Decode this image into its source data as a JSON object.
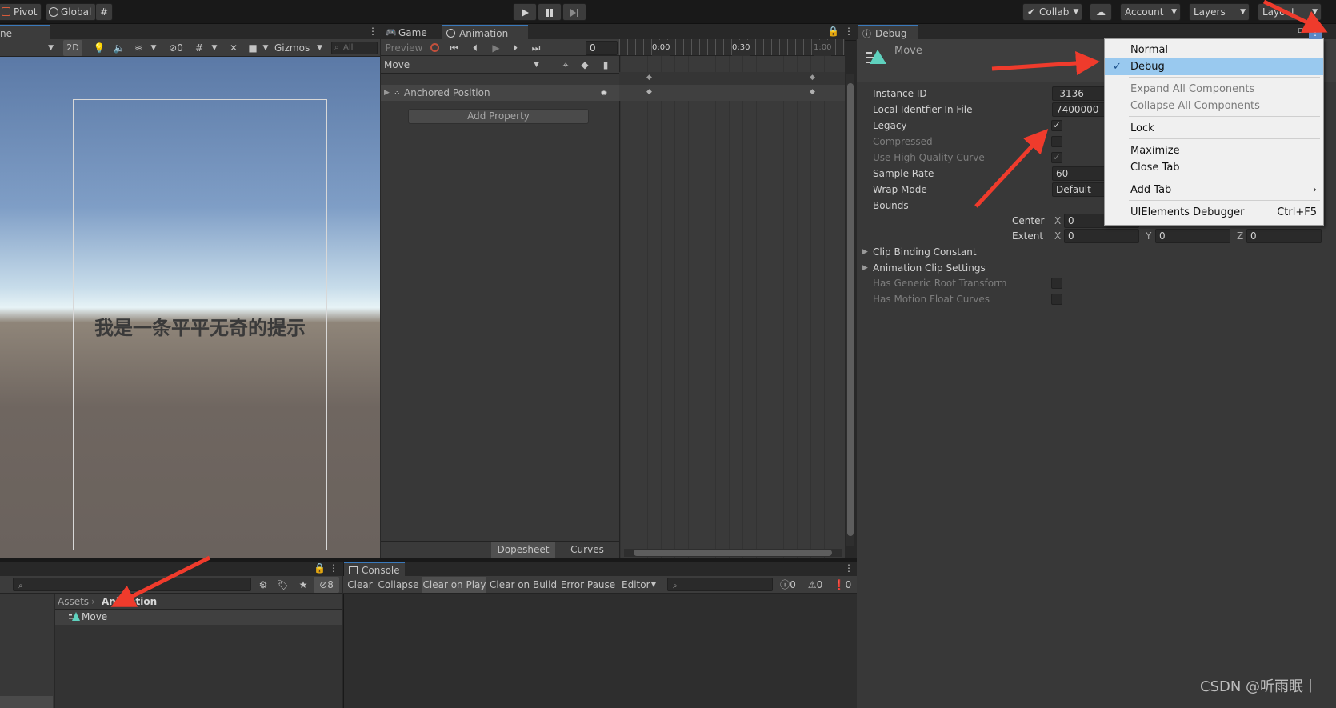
{
  "top_toolbar": {
    "pivot": "Pivot",
    "global": "Global",
    "collab": "Collab",
    "account": "Account",
    "layers": "Layers",
    "layout": "Layout"
  },
  "scene": {
    "tab_label": "ne",
    "mode_2d": "2D",
    "hidden_count": "0",
    "gizmos": "Gizmos",
    "search_placeholder": "All",
    "viewport_text": "我是一条平平无奇的提示"
  },
  "game_tab": "Game",
  "animation": {
    "tab_label": "Animation",
    "preview": "Preview",
    "frame_value": "0",
    "clip_select": "Move",
    "property": "Anchored Position",
    "add_property": "Add Property",
    "ruler_ticks": [
      "0:00",
      "0:30",
      "1:00"
    ],
    "bottom_tabs": [
      "Dopesheet",
      "Curves"
    ]
  },
  "inspector": {
    "tab_label": "Debug",
    "object_name": "Move",
    "rows": [
      {
        "label": "Instance ID",
        "value": "-3136",
        "dim": false
      },
      {
        "label": "Local Identfier In File",
        "value": "7400000",
        "dim": false
      },
      {
        "label": "Legacy",
        "value": "✓",
        "dim": false
      },
      {
        "label": "Compressed",
        "value": "",
        "dim": true
      },
      {
        "label": "Use High Quality Curve",
        "value": "✓",
        "dim": true
      },
      {
        "label": "Sample Rate",
        "value": "60",
        "dim": false
      },
      {
        "label": "Wrap Mode",
        "value": "Default",
        "dim": false
      },
      {
        "label": "Bounds",
        "value": "",
        "dim": false
      }
    ],
    "center_label": "Center",
    "extent_label": "Extent",
    "axis_labels": [
      "X",
      "Y",
      "Z"
    ],
    "center_x": "0",
    "extent_values": [
      "0",
      "0",
      "0"
    ],
    "foldouts": [
      "Clip Binding Constant",
      "Animation Clip Settings"
    ],
    "extra_rows": [
      "Has Generic Root Transform",
      "Has Motion Float Curves"
    ]
  },
  "context_menu": {
    "items": [
      {
        "label": "Normal",
        "shortcut": "",
        "disabled": false,
        "selected": false
      },
      {
        "label": "Debug",
        "shortcut": "",
        "disabled": false,
        "selected": true
      },
      {
        "label": "Expand All Components",
        "shortcut": "",
        "disabled": true,
        "selected": false
      },
      {
        "label": "Collapse All Components",
        "shortcut": "",
        "disabled": true,
        "selected": false
      },
      {
        "label": "Lock",
        "shortcut": "",
        "disabled": false,
        "selected": false
      },
      {
        "label": "Maximize",
        "shortcut": "",
        "disabled": false,
        "selected": false
      },
      {
        "label": "Close Tab",
        "shortcut": "",
        "disabled": false,
        "selected": false
      },
      {
        "label": "Add Tab",
        "shortcut": "›",
        "disabled": false,
        "selected": false
      },
      {
        "label": "UIElements Debugger",
        "shortcut": "Ctrl+F5",
        "disabled": false,
        "selected": false
      }
    ]
  },
  "project": {
    "hidden_count": "8",
    "breadcrumb_root": "Assets",
    "breadcrumb_folder": "Animation",
    "item": "Move"
  },
  "console": {
    "tab_label": "Console",
    "buttons": [
      "Clear",
      "Collapse",
      "Clear on Play",
      "Clear on Build",
      "Error Pause",
      "Editor"
    ],
    "counts": [
      "0",
      "0",
      "0"
    ]
  },
  "watermark": "CSDN @听雨眠丨",
  "colors": {
    "accent": "#3a79bb",
    "arrow": "#ef3b2c",
    "menu_highlight": "#99c9ef"
  }
}
